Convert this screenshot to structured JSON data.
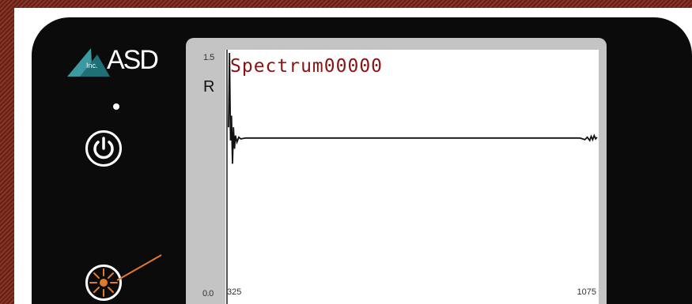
{
  "device": {
    "brand": "ASD",
    "brand_suffix": "Inc.",
    "colors": {
      "body": "#0b0b0b",
      "logo_teal": "#3a9aa0",
      "laser_orange": "#e07a2e",
      "title_red": "#8b1212"
    },
    "icons": [
      "asd-logo-icon",
      "status-led-icon",
      "power-icon",
      "laser-icon"
    ]
  },
  "screen": {
    "title": "Spectrum00000",
    "y_label": "R",
    "y_max_label": "1.5",
    "y_min_label": "0.0",
    "x_min_label": "325",
    "x_max_label": "1075"
  },
  "chart_data": {
    "type": "line",
    "ylabel": "R",
    "xlim": [
      325,
      1075
    ],
    "ylim": [
      0.0,
      1.5
    ],
    "grid": false,
    "series": [
      {
        "x": [
          325,
          327,
          329,
          331,
          333,
          335,
          337,
          339,
          342,
          346,
          350,
          360,
          380,
          420,
          500,
          600,
          700,
          800,
          900,
          1000,
          1040,
          1050,
          1055,
          1060,
          1063,
          1066,
          1069,
          1072,
          1075
        ],
        "values": [
          1.05,
          1.5,
          0.97,
          1.12,
          0.83,
          1.05,
          0.92,
          1.0,
          0.96,
          0.99,
          0.98,
          0.985,
          0.985,
          0.985,
          0.985,
          0.985,
          0.985,
          0.985,
          0.985,
          0.985,
          0.985,
          0.975,
          0.99,
          0.97,
          0.995,
          0.975,
          1.0,
          0.98,
          0.99
        ]
      }
    ]
  }
}
